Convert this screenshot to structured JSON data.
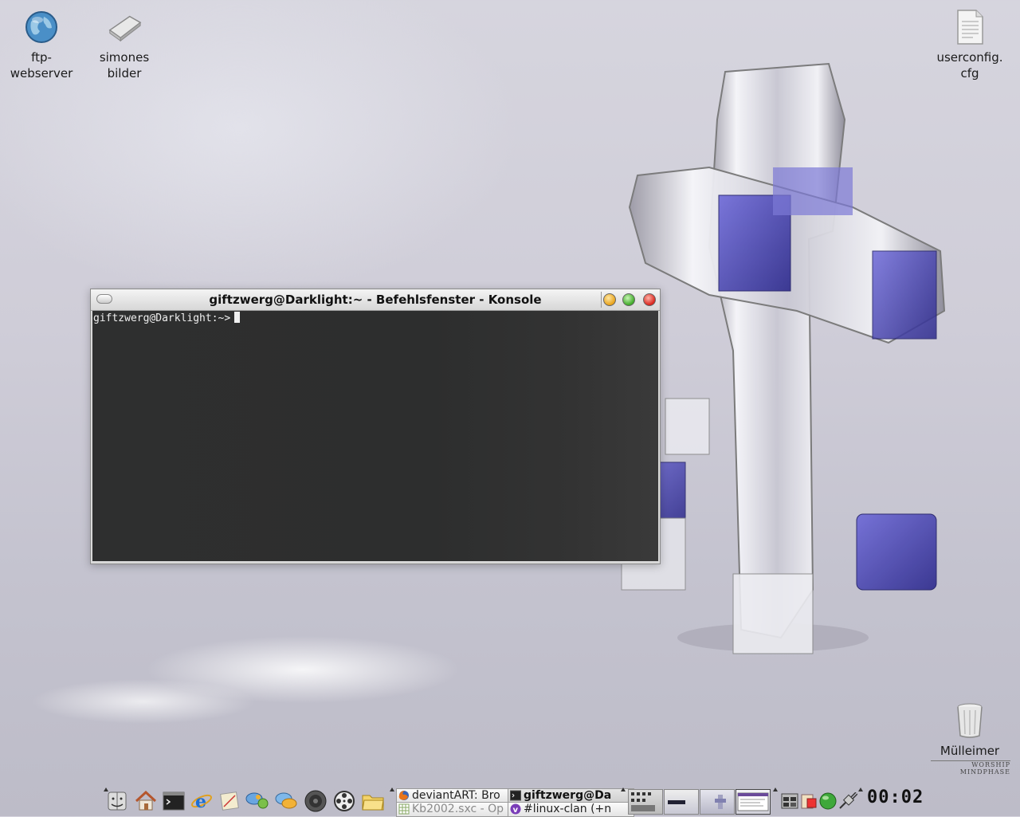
{
  "desktop": {
    "icons": [
      {
        "line1": "ftp-",
        "line2": "webserver"
      },
      {
        "line1": "simones",
        "line2": "bilder"
      },
      {
        "line1": "userconfig.",
        "line2": "cfg"
      }
    ],
    "trash_label": "Mülleimer",
    "wallpaper_signature": "WORSHIP MINDPHASE"
  },
  "window": {
    "title": "giftzwerg@Darklight:~ - Befehlsfenster - Konsole",
    "prompt": "giftzwerg@Darklight:~>"
  },
  "taskbar": {
    "tasks": [
      {
        "label": "deviantART: Bro",
        "icon": "firefox-icon"
      },
      {
        "label": "giftzwerg@Da",
        "icon": "terminal-icon",
        "active": true
      },
      {
        "label": "Kb2002.sxc - Op",
        "icon": "spreadsheet-icon"
      },
      {
        "label": "#linux-clan (+n",
        "icon": "irc-icon"
      }
    ],
    "clock": "00:02"
  },
  "colors": {
    "terminal_bg": "#2d2e2e",
    "terminal_fg": "#f0f0f0",
    "titlebar": "#e6e6e6",
    "cross_blue": "#4a45b8"
  }
}
